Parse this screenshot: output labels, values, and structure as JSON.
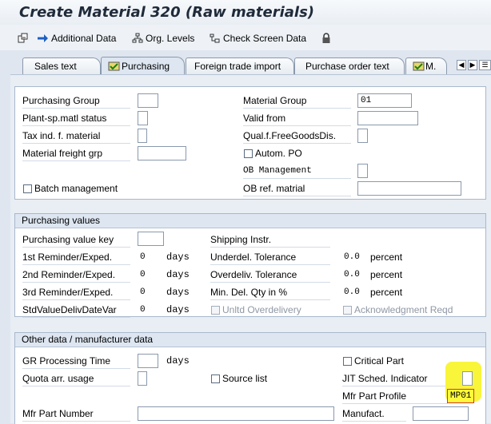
{
  "window": {
    "title": "Create Material 320 (Raw materials)"
  },
  "toolbar": {
    "additional_data": "Additional Data",
    "org_levels": "Org. Levels",
    "check_screen_data": "Check Screen Data"
  },
  "tabs": {
    "sales_text": "Sales text",
    "purchasing": "Purchasing",
    "foreign_trade": "Foreign trade import",
    "po_text": "Purchase order text",
    "more": "M."
  },
  "general": {
    "purchasing_group": "Purchasing Group",
    "material_group": "Material Group",
    "material_group_value": "01",
    "plant_sp_status": "Plant-sp.matl status",
    "valid_from": "Valid from",
    "tax_ind": "Tax ind. f. material",
    "qual_free_goods": "Qual.f.FreeGoodsDis.",
    "freight_grp": "Material freight grp",
    "autom_po": "Autom. PO",
    "ob_management": "OB Management",
    "batch_management": "Batch management",
    "ob_ref": "OB ref. matrial"
  },
  "purchasing_values": {
    "header": "Purchasing values",
    "value_key": "Purchasing value key",
    "shipping_instr": "Shipping Instr.",
    "reminder1": "1st Reminder/Exped.",
    "reminder1_value": "0",
    "reminder2": "2nd Reminder/Exped.",
    "reminder2_value": "0",
    "reminder3": "3rd Reminder/Exped.",
    "reminder3_value": "0",
    "stdvalue": "StdValueDelivDateVar",
    "stdvalue_value": "0",
    "days": "days",
    "underdel": "Underdel. Tolerance",
    "underdel_value": "0.0",
    "overdel": "Overdeliv. Tolerance",
    "overdel_value": "0.0",
    "mindel": "Min. Del. Qty in %",
    "mindel_value": "0.0",
    "percent": "percent",
    "unltd_overdelivery": "Unltd Overdelivery",
    "ack_reqd": "Acknowledgment Reqd"
  },
  "other_data": {
    "header": "Other data / manufacturer data",
    "gr_processing": "GR Processing Time",
    "days": "days",
    "critical_part": "Critical Part",
    "quota_arr": "Quota arr. usage",
    "source_list": "Source list",
    "jit_indicator": "JIT Sched. Indicator",
    "mfr_part_profile": "Mfr Part Profile",
    "mfr_part_profile_value": "MP01",
    "mfr_part_number": "Mfr Part Number",
    "manufact": "Manufact."
  },
  "colors": {
    "highlight": "#f8f53a",
    "accent_border": "#d4343b"
  }
}
